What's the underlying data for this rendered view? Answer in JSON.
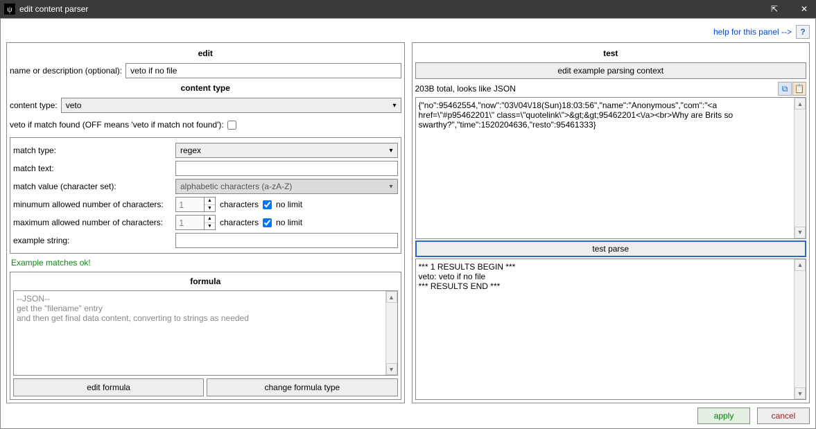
{
  "window": {
    "title": "edit content parser"
  },
  "help": {
    "link_text": "help for this panel -->",
    "icon": "?"
  },
  "edit": {
    "heading": "edit",
    "name_label": "name or description (optional):",
    "name_value": "veto if no file",
    "content_type_heading": "content type",
    "content_type_label": "content type:",
    "content_type_value": "veto",
    "veto_label": "veto if match found (OFF means 'veto if match not found'):",
    "veto_checked": false,
    "match_type_label": "match type:",
    "match_type_value": "regex",
    "match_text_label": "match text:",
    "match_text_value": "",
    "match_value_label": "match value (character set):",
    "match_value_value": "alphabetic characters (a-zA-Z)",
    "min_label": "minumum allowed number of characters:",
    "min_value": "1",
    "max_label": "maximum allowed number of characters:",
    "max_value": "1",
    "characters_text": "characters",
    "no_limit_text": "no limit",
    "example_label": "example string:",
    "example_value": "",
    "ok_message": "Example matches ok!"
  },
  "formula": {
    "heading": "formula",
    "line1": "--JSON--",
    "line2": "get the \"filename\" entry",
    "line3": "and then get final data content, converting to strings as needed",
    "btn_edit": "edit formula",
    "btn_change": "change formula type"
  },
  "test": {
    "heading": "test",
    "edit_context_btn": "edit example parsing context",
    "status_text": "203B total, looks like JSON",
    "sample_json": "{\"no\":95462554,\"now\":\"03\\/04\\/18(Sun)18:03:56\",\"name\":\"Anonymous\",\"com\":\"<a href=\\\"#p95462201\\\" class=\\\"quotelink\\\">&gt;&gt;95462201<\\/a><br>Why are Brits so swarthy?\",\"time\":1520204636,\"resto\":95461333}",
    "parse_btn": "test parse",
    "result_line1": "*** 1 RESULTS BEGIN ***",
    "result_line2": "veto: veto if no file",
    "result_line3": "*** RESULTS END ***"
  },
  "footer": {
    "apply": "apply",
    "cancel": "cancel"
  }
}
